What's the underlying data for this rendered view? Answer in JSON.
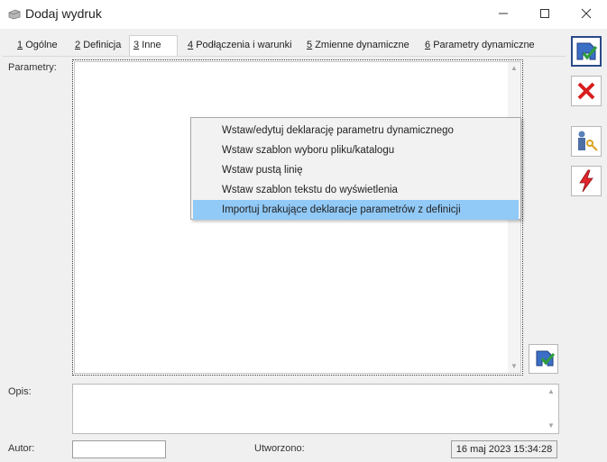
{
  "window": {
    "title": "Dodaj wydruk",
    "icon": "window-app-icon"
  },
  "tabs": [
    {
      "num": "1",
      "label": "Ogólne",
      "active": false
    },
    {
      "num": "2",
      "label": "Definicja",
      "active": false
    },
    {
      "num": "3",
      "label": "Inne",
      "active": true
    },
    {
      "num": "4",
      "label": "Podłączenia i warunki",
      "active": false
    },
    {
      "num": "5",
      "label": "Zmienne dynamiczne",
      "active": false
    },
    {
      "num": "6",
      "label": "Parametry dynamiczne",
      "active": false
    }
  ],
  "form": {
    "parametry_label": "Parametry:",
    "opis_label": "Opis:",
    "autor_label": "Autor:",
    "autor_value": "",
    "utworzono_label": "Utworzono:",
    "utworzono_value": "16 maj 2023 15:34:28"
  },
  "context_menu": {
    "items": [
      {
        "label": "Wstaw/edytuj deklarację parametru dynamicznego",
        "highlighted": false
      },
      {
        "label": "Wstaw szablon wyboru pliku/katalogu",
        "highlighted": false
      },
      {
        "label": "Wstaw pustą linię",
        "highlighted": false
      },
      {
        "label": "Wstaw szablon tekstu do wyświetlenia",
        "highlighted": false
      },
      {
        "label": "Importuj brakujące deklaracje parametrów z definicji",
        "highlighted": true
      }
    ],
    "highlight_color": "#91c9f7"
  },
  "side_buttons": [
    "save-icon",
    "cancel-icon",
    "user-key-icon",
    "lightning-icon"
  ],
  "colors": {
    "accent_blue": "#2a4a8a",
    "cancel_red": "#d81e1e",
    "save_green": "#2e9e3e"
  }
}
